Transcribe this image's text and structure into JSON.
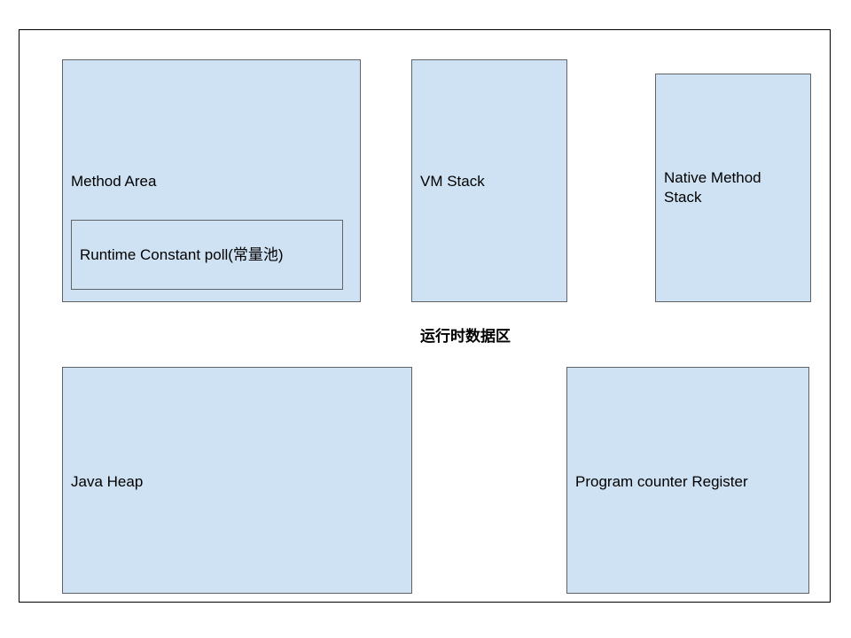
{
  "diagram": {
    "title": "运行时数据区",
    "method_area": {
      "label": "Method Area",
      "runtime_constant_pool": "Runtime Constant poll(常量池)"
    },
    "vm_stack": "VM Stack",
    "native_method_stack": "Native Method\nStack",
    "java_heap": "Java Heap",
    "program_counter_register": "Program counter Register"
  },
  "colors": {
    "box_fill": "#cfe2f3",
    "box_border": "#5f6368",
    "frame_border": "#000000"
  }
}
